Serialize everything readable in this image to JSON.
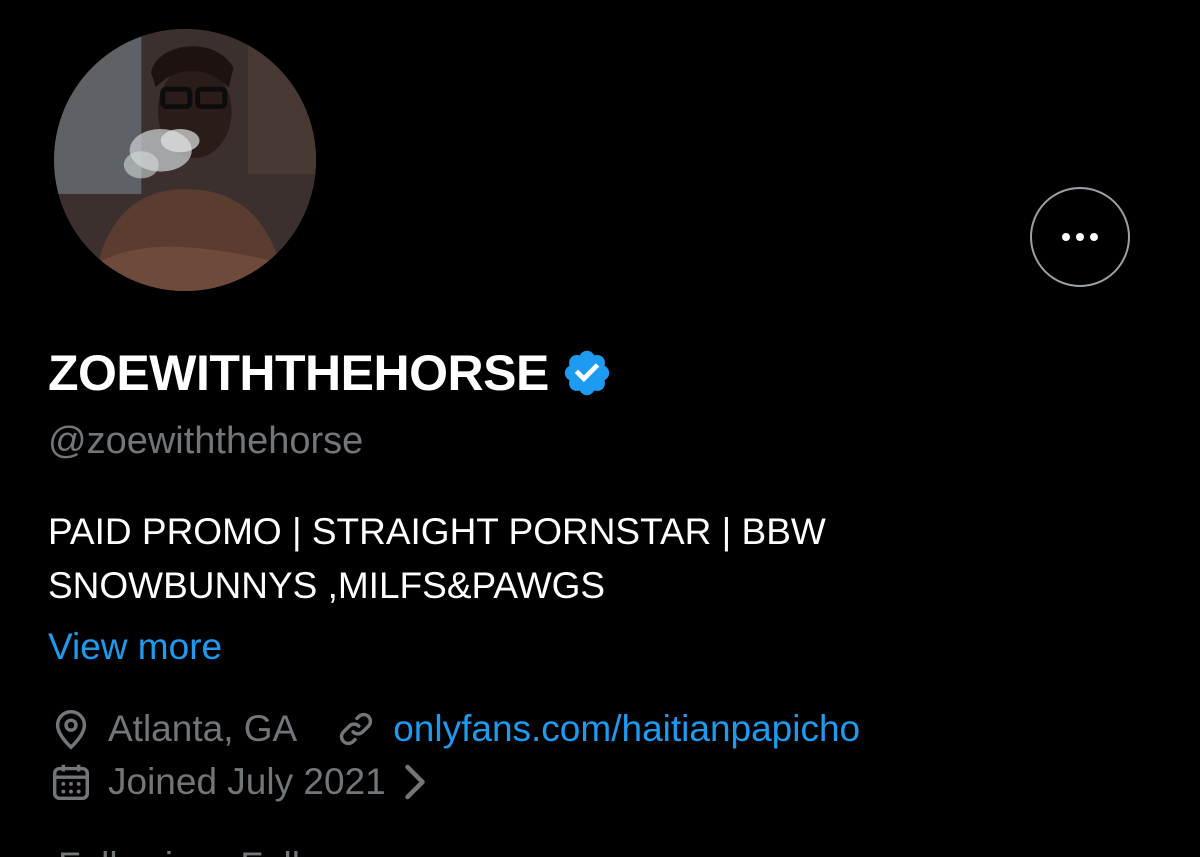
{
  "profile": {
    "avatar_alt": "Profile photo",
    "display_name": "ZOEWITHTHEHORSE",
    "verified": true,
    "verified_color": "#1d9bf0",
    "handle": "@zoewiththehorse",
    "bio_lines": [
      "PAID PROMO | STRAIGHT PORNSTAR | BBW",
      "SNOWBUNNYS ,MILFS&PAWGS"
    ],
    "view_more_label": "View more",
    "location": "Atlanta, GA",
    "website": "onlyfans.com/haitianpapicho",
    "joined": "Joined July 2021"
  },
  "follow": {
    "following_count": "",
    "following_label": "Following",
    "followers_count": "",
    "followers_label": "Followers"
  },
  "icons": {
    "more": "more-horizontal-icon",
    "verified": "verified-badge-icon",
    "location": "location-pin-icon",
    "link": "link-icon",
    "calendar": "calendar-icon",
    "chevron": "chevron-right-icon"
  },
  "colors": {
    "background": "#000000",
    "text_primary": "#ffffff",
    "text_secondary": "#71767b",
    "accent": "#1d9bf0"
  }
}
